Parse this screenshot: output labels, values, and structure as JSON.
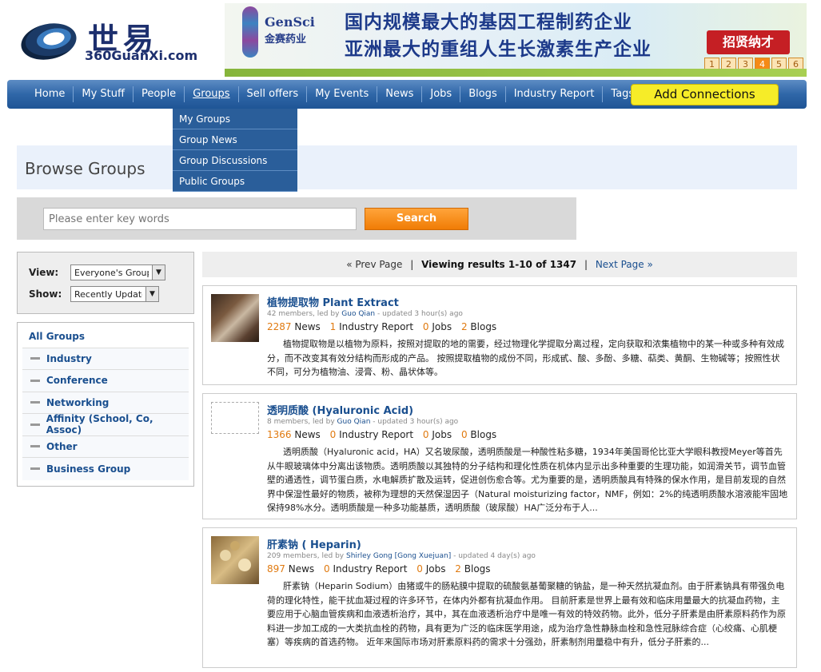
{
  "logo": {
    "cn": "世易",
    "url": "360GuanXi.com"
  },
  "banner": {
    "brand_en": "GenSci",
    "brand_cn": "金赛药业",
    "line1": "国内规模最大的基因工程制药企业",
    "line2": "亚洲最大的重组人生长激素生产企业",
    "recruit": "招贤纳才",
    "pages": [
      "1",
      "2",
      "3",
      "4",
      "5",
      "6"
    ],
    "active_page": "4"
  },
  "nav": {
    "items": [
      "Home",
      "My Stuff",
      "People",
      "Groups",
      "Sell offers",
      "My Events",
      "News",
      "Jobs",
      "Blogs",
      "Industry Report",
      "Tags"
    ],
    "current": "Groups",
    "add_connections": "Add Connections"
  },
  "groups_menu": [
    "My Groups",
    "Group News",
    "Group Discussions",
    "Public Groups"
  ],
  "page_title": "Browse Groups",
  "search": {
    "placeholder": "Please enter key words",
    "button": "Search"
  },
  "filters": {
    "view_label": "View:",
    "view_value": "Everyone's Groups",
    "show_label": "Show:",
    "show_value": "Recently Updated"
  },
  "categories": [
    "All Groups",
    "Industry",
    "Conference",
    "Networking",
    "Affinity (School, Co, Assoc)",
    "Other",
    "Business Group"
  ],
  "pager": {
    "prev": "« Prev Page",
    "sep": "|",
    "summary": "Viewing results 1-10 of 1347",
    "next": "Next Page »"
  },
  "groups": [
    {
      "title": "植物提取物   Plant Extract",
      "members": "42 members, led by",
      "leader": "Guo Qian",
      "updated": "- updated 3 hour(s) ago",
      "news": "2287",
      "reports": "1",
      "jobs": "0",
      "blogs": "2",
      "description": "植物提取物是以植物为原料，按照对提取的地的需要，经过物理化学提取分离过程，定向获取和浓集植物中的某一种或多种有效成分，而不改变其有效分结构而形成的产品。     按照提取植物的成份不同，形成甙、酸、多酚、多糖、萜类、黄酮、生物碱等；按照性状不同，可分为植物油、浸膏、粉、晶状体等。"
    },
    {
      "title": "透明质酸 (Hyaluronic Acid)",
      "members": "8 members, led by",
      "leader": "Guo Qian",
      "updated": "- updated 3 hour(s) ago",
      "news": "1366",
      "reports": "0",
      "jobs": "0",
      "blogs": "0",
      "description": "透明质酸（Hyaluronic acid，HA）又名玻尿酸，透明质酸是一种酸性粘多糖，1934年美国哥伦比亚大学眼科教授Meyer等首先从牛眼玻璃体中分离出该物质。透明质酸以其独特的分子结构和理化性质在机体内显示出多种重要的生理功能，如润滑关节，调节血管壁的通透性，调节蛋白质，水电解质扩散及运转，促进创伤愈合等。尤为重要的是，透明质酸具有特殊的保水作用，是目前发现的自然界中保湿性最好的物质，被称为理想的天然保湿因子（Natural moisturizing factor，NMF，例如：2%的纯透明质酸水溶液能牢固地保持98%水分。透明质酸是一种多功能基质，透明质酸（玻尿酸）HA广泛分布于人..."
    },
    {
      "title": "肝素钠 ( Heparin)",
      "members": "209 members, led by",
      "leader": "Shirley Gong [Gong Xuejuan]",
      "updated": "- updated 4 day(s) ago",
      "news": "897",
      "reports": "0",
      "jobs": "0",
      "blogs": "2",
      "description": "肝素钠（Heparin Sodium）由猪或牛的肠粘膜中提取的硫酸氨基葡聚糖的钠盐，是一种天然抗凝血剂。由于肝素钠具有带强负电荷的理化特性，能干扰血凝过程的许多环节，在体内外都有抗凝血作用。      目前肝素是世界上最有效和临床用量最大的抗凝血药物，主要应用于心脑血管疾病和血液透析治疗，其中，其在血液透析治疗中是唯一有效的特效药物。此外，低分子肝素是由肝素原料药作为原料进一步加工成的一大类抗血栓的药物，具有更为广泛的临床医学用途，成为治疗急性静脉血栓和急性冠脉综合症（心绞痛、心肌梗塞）等疾病的首选药物。        近年来国际市场对肝素原料药的需求十分强劲，肝素制剂用量稳中有升，低分子肝素的..."
    }
  ],
  "labels": {
    "news": "News",
    "reports": "Industry Report",
    "jobs": "Jobs",
    "blogs": "Blogs"
  }
}
